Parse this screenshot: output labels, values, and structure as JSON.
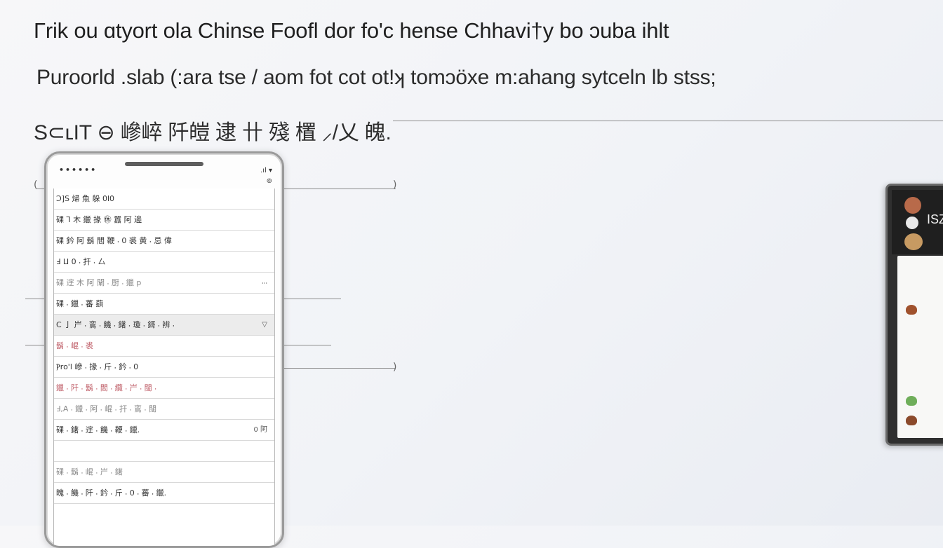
{
  "heading": {
    "line1": "Γrik ou ɑtyort ola Chinse Foofl dor fo'c hense Chhavi†y bo ɔuba ihlt",
    "line2": "Puroorld .slab (:ara tse / aom fot cot ot!ʞ tomɔöxe m:ahang sytceln lb stss;",
    "line3": "S⊂ʟIT ⊖ 㠁崪 阡皚 逮 卄 殘 㯰 ⸝/乂 魄."
  },
  "status_bar": {
    "dots": "••••••",
    "signal": ".ıl ▾",
    "sync": "⊚"
  },
  "rows": [
    {
      "text": "Ↄ]S 㷌 魚 躲 0l0",
      "style": "normal",
      "value": ""
    },
    {
      "text": "䂺 ⅂ ⽊ 鑞 掾 ㊡ 囂 阿 邊",
      "style": "normal",
      "value": ""
    },
    {
      "text": "䂺 鈐 阿 鬍 閻 鞭 ⸳ 0 裘 ⻩ ⸳ 忌 偉",
      "style": "normal",
      "value": ""
    },
    {
      "text": "Ⅎ ⵡ 0 ⸳ 扞 ⸳ 厶",
      "style": "normal",
      "value": ""
    },
    {
      "text": "䂺 䢓 ⽊ 阿 闡 ⸳ 厨 ⸳ 鑞 p",
      "style": "muted",
      "value": "⸳⸳⸳"
    },
    {
      "text": "䂺 ⸳ 鑞 ⸳ 蕃 蕻",
      "style": "normal",
      "value": ""
    },
    {
      "text": "Ⅽ ⼅ 屵 ⸳ 鵉 ⸳ 饑 ⸳ 鐯 ⸳ 瓊 ⸳ 鎶 ⸳ 辨 ⸳",
      "style": "selected",
      "value": "▽"
    },
    {
      "text": "鬍 ⸳ 崐 ⸳ 裘",
      "style": "pink",
      "value": ""
    },
    {
      "text": "Ⲣro'l 㠁 ⸳ 掾 ⸳ 斤 ⸳ 鈐 ⸳ 0",
      "style": "normal",
      "value": ""
    },
    {
      "text": "鑞 ⸳ 阡 ⸳ 鬍 ⸳ 閻 ⸳ 纜 ⸳ 屵 ⸳ 闊 ⸳",
      "style": "pink",
      "value": ""
    },
    {
      "text": "Ⅎ,A ⸳ 鑞 ⸳ 阿 ⸳ 崐 ⸳ 扞 ⸳ 鵉 ⸳ 闊",
      "style": "muted",
      "value": ""
    },
    {
      "text": "䂺 ⸳ 鐯 ⸳ 䢓 ⸳ 饑 ⸳ 鞭 ⸳ 鑞.",
      "style": "normal",
      "value": "0 阿"
    },
    {
      "text": "",
      "style": "normal",
      "value": ""
    },
    {
      "text": "䂺 ⸳ 鬍 ⸳ 崐 ⸳ 屵 ⸳ 鐯",
      "style": "muted",
      "value": ""
    },
    {
      "text": "䁛 ⸳ 饑 ⸳ 阡 ⸳ 鈐 ⸳ 斤 ⸳ 0 ⸳ 蕃 ⸳ 鑞.",
      "style": "normal",
      "value": ""
    }
  ],
  "side_device": {
    "label": "ISZ"
  },
  "colors": {
    "accent_pink": "#c0606a",
    "frame": "#9a9a9a",
    "dark_panel": "#2f2f2f"
  }
}
